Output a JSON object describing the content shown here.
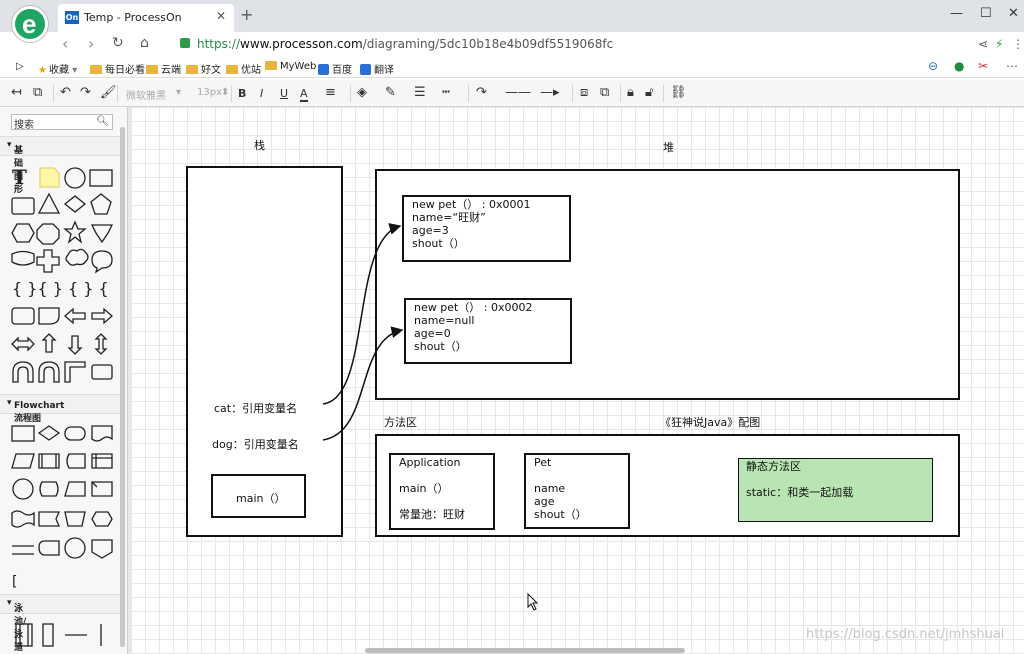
{
  "browser": {
    "logo_letter": "e",
    "tab_favicon": "On",
    "tab_title": "Temp - ProcessOn",
    "new_tab": "+",
    "url_scheme": "https://",
    "url_host": "www.processon.com",
    "url_path": "/diagraming/5dc10b18e4b09df5519068fc",
    "window_controls": [
      "—",
      "☐",
      "✕"
    ]
  },
  "bookmarks": {
    "items": [
      {
        "label": "收藏",
        "icon": "star-icon"
      },
      {
        "label": "每日必看",
        "icon": "folder-icon"
      },
      {
        "label": "云端",
        "icon": "folder-icon"
      },
      {
        "label": "好文",
        "icon": "folder-icon"
      },
      {
        "label": "优站",
        "icon": "folder-icon"
      },
      {
        "label": "MyWeb",
        "icon": "folder-icon"
      },
      {
        "label": "百度",
        "icon": "paw-icon"
      },
      {
        "label": "翻译",
        "icon": "translate-icon"
      }
    ]
  },
  "toolbar": {
    "font_family": "微软雅黑",
    "font_size": "13px",
    "bold": "B",
    "italic": "I",
    "underline": "U",
    "text_color": "A"
  },
  "sidebar": {
    "search_placeholder": "搜索",
    "sections": [
      "基础图形",
      "Flowchart 流程图",
      "泳池/泳道"
    ]
  },
  "diagram": {
    "stack_title": "栈",
    "heap_title": "堆",
    "method_area_title": "方法区",
    "caption": "《狂神说Java》配图",
    "cat_label": "cat：引用变量名",
    "dog_label": "dog：引用变量名",
    "main_label": "main（）",
    "pet1": [
      "new pet（）  :   0x0001",
      "name=“旺财”",
      "age=3",
      "shout（）"
    ],
    "pet2": [
      "new pet（）  :   0x0002",
      "name=null",
      "age=0",
      "shout（）"
    ],
    "application": [
      "Application",
      "",
      "main（）",
      "",
      "常量池：旺财"
    ],
    "pet_class": [
      "Pet",
      "",
      "name",
      "age",
      "shout（）"
    ],
    "static_area": [
      "静态方法区",
      "",
      "static：和类一起加载"
    ],
    "static_color": "#b9e5b4"
  },
  "watermark": "https://blog.csdn.net/jmhshual"
}
